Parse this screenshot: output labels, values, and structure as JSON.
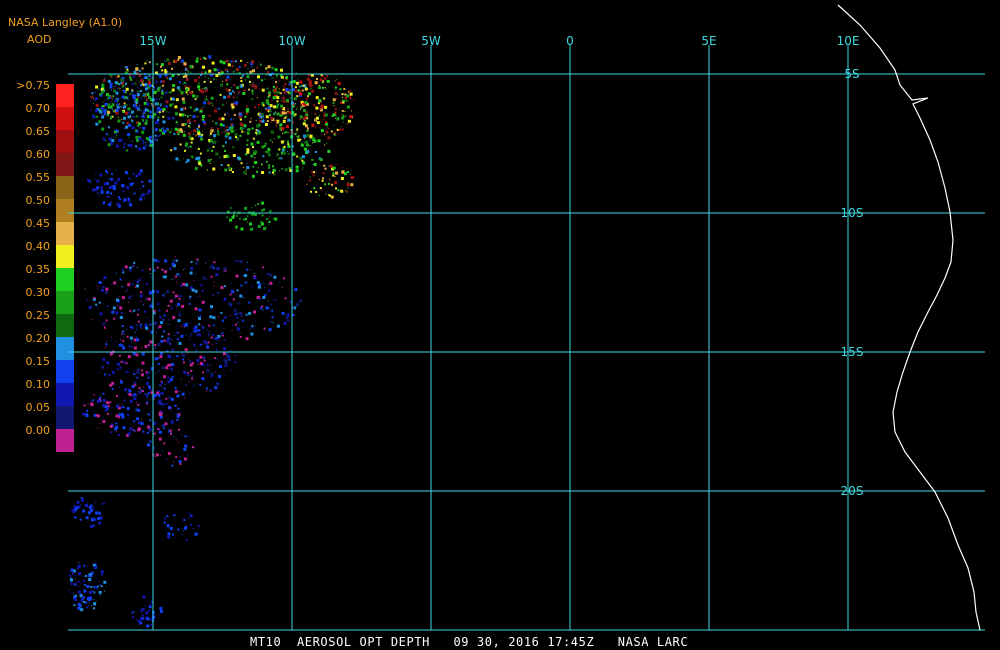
{
  "header": {
    "title": "NASA Langley (A1.0)",
    "unit": "AOD"
  },
  "footer": {
    "caption": "MT10  AEROSOL OPT DEPTH   09 30, 2016 17:45Z   NASA LARC"
  },
  "grid": {
    "longitude_labels": [
      "15W",
      "10W",
      "5W",
      "0",
      "5E",
      "10E"
    ],
    "longitudes": [
      -15,
      -10,
      -5,
      0,
      5,
      10
    ],
    "latitude_labels": [
      "5S",
      "10S",
      "15S",
      "20S"
    ],
    "latitudes": [
      -5,
      -10,
      -15,
      -20
    ],
    "line_color": "#40d8e0"
  },
  "legend": {
    "labels": [
      ">0.75",
      "0.70",
      "0.65",
      "0.60",
      "0.55",
      "0.50",
      "0.45",
      "0.40",
      "0.35",
      "0.30",
      "0.25",
      "0.20",
      "0.15",
      "0.10",
      "0.05",
      "0.00"
    ],
    "colors": [
      "#ff2020",
      "#d01010",
      "#a01010",
      "#801818",
      "#8a6418",
      "#b08020",
      "#e8b048",
      "#f0f020",
      "#20d020",
      "#18a018",
      "#106810",
      "#2090e0",
      "#1040f0",
      "#1018b0",
      "#101870",
      "#c02090"
    ]
  },
  "colors": {
    "label_text": "#f0a020",
    "coastline": "#ffffff",
    "background": "#000000"
  }
}
